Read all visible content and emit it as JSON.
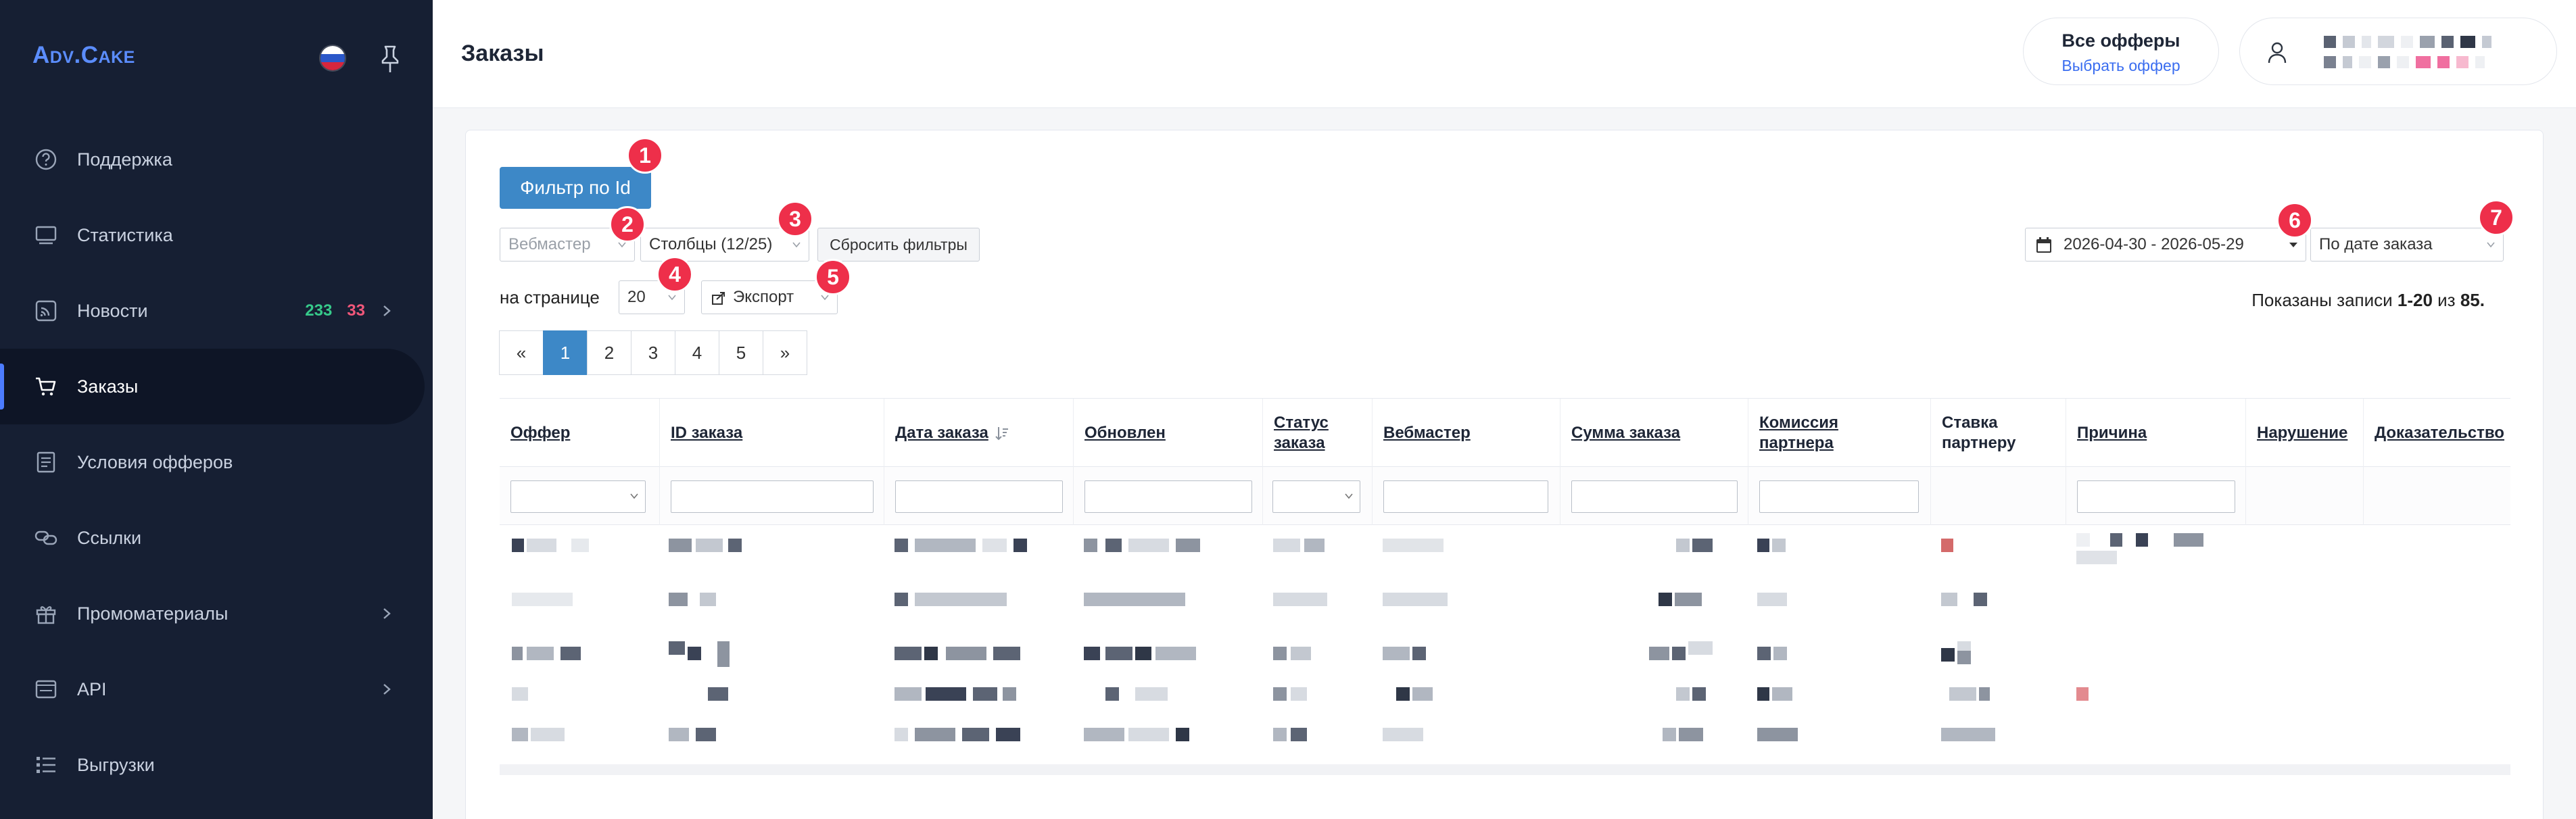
{
  "sidebar": {
    "logo_prefix": "Adv",
    "logo_suffix": "Cake",
    "items": [
      {
        "label": "Поддержка",
        "icon": "help-circle-icon"
      },
      {
        "label": "Статистика",
        "icon": "monitor-icon"
      },
      {
        "label": "Новости",
        "icon": "rss-icon",
        "badge_new": "233",
        "badge_unread": "33",
        "has_children": true
      },
      {
        "label": "Заказы",
        "icon": "cart-icon",
        "active": true
      },
      {
        "label": "Условия офферов",
        "icon": "document-list-icon"
      },
      {
        "label": "Ссылки",
        "icon": "link-icon"
      },
      {
        "label": "Промоматериалы",
        "icon": "gift-icon",
        "has_children": true
      },
      {
        "label": "API",
        "icon": "api-icon",
        "has_children": true
      },
      {
        "label": "Выгрузки",
        "icon": "list-icon"
      }
    ]
  },
  "header": {
    "title": "Заказы",
    "offers_title": "Все офферы",
    "offers_link": "Выбрать оффер"
  },
  "toolbar": {
    "filter_by_id": "Фильтр по Id",
    "webmaster_placeholder": "Вебмастер",
    "columns": "Столбцы (12/25)",
    "reset_filters": "Сбросить фильтры",
    "per_page_label": "на странице",
    "per_page_value": "20",
    "export": "Экспорт",
    "date_range": "2026-04-30 - 2026-05-29",
    "date_mode": "По дате заказа",
    "summary_prefix": "Показаны записи ",
    "summary_range": "1-20",
    "summary_mid": " из ",
    "summary_total": "85."
  },
  "markers": [
    "1",
    "2",
    "3",
    "4",
    "5",
    "6",
    "7"
  ],
  "pagination": [
    "«",
    "1",
    "2",
    "3",
    "4",
    "5",
    "»"
  ],
  "table": {
    "columns": [
      {
        "label": "Оффер",
        "link": true
      },
      {
        "label": "ID заказа",
        "link": true
      },
      {
        "label": "Дата заказа",
        "link": true,
        "sorted": true
      },
      {
        "label": "Обновлен",
        "link": true
      },
      {
        "label": "Статус заказа",
        "link": true
      },
      {
        "label": "Вебмастер",
        "link": true
      },
      {
        "label": "Сумма заказа",
        "link": true
      },
      {
        "label": "Комиссия партнера",
        "link": true
      },
      {
        "label": "Ставка партнеру",
        "link": false
      },
      {
        "label": "Причина",
        "link": true
      },
      {
        "label": "Нарушение",
        "link": true
      },
      {
        "label": "Доказательство",
        "link": true
      }
    ]
  },
  "colors": {
    "sidebar_bg": "#161f33",
    "accent": "#3d88c7",
    "marker": "#ee2f4a",
    "badge_green": "#36c98a",
    "badge_red": "#f0577a"
  }
}
